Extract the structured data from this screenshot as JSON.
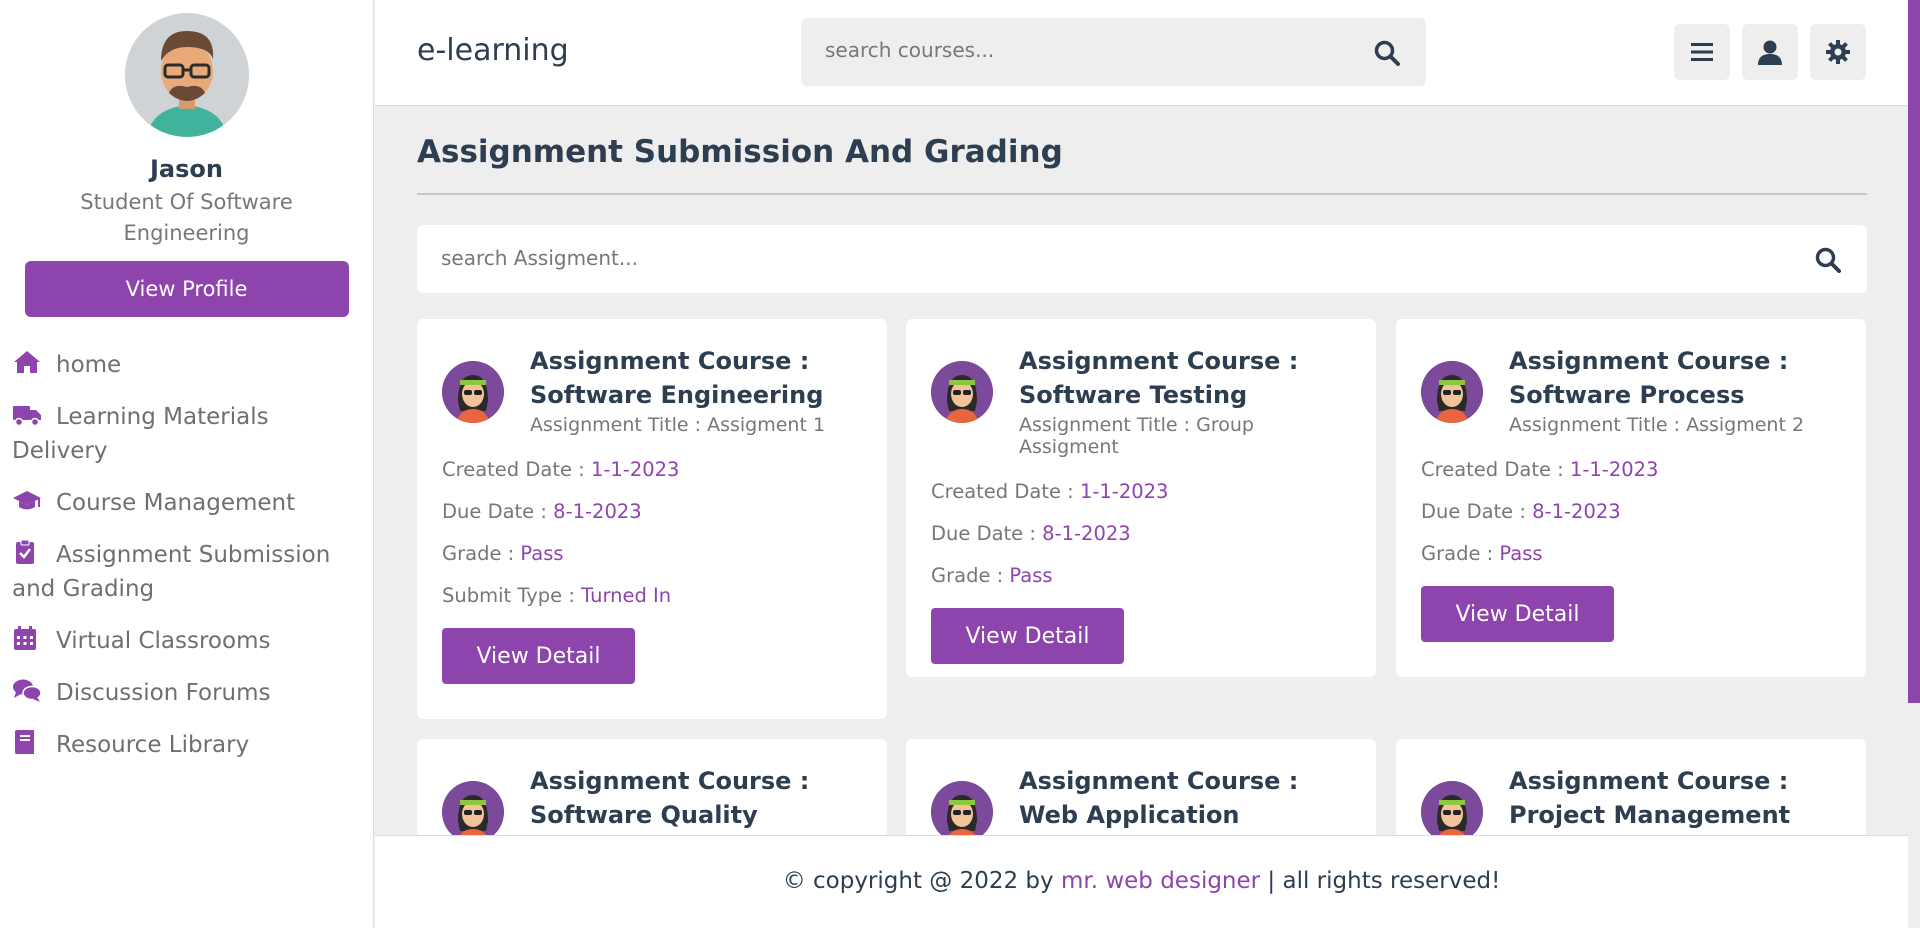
{
  "sidebar": {
    "profile": {
      "name": "Jason",
      "role": "Student Of Software Engineering",
      "button_label": "View Profile"
    },
    "items": [
      {
        "label": "home",
        "icon": "home-icon"
      },
      {
        "label": "Learning Materials Delivery",
        "icon": "truck-icon"
      },
      {
        "label": "Course Management",
        "icon": "graduation-cap-icon"
      },
      {
        "label": "Assignment Submission and Grading",
        "icon": "clipboard-check-icon"
      },
      {
        "label": "Virtual Classrooms",
        "icon": "calendar-icon"
      },
      {
        "label": "Discussion Forums",
        "icon": "comments-icon"
      },
      {
        "label": "Resource Library",
        "icon": "book-icon"
      }
    ]
  },
  "header": {
    "brand": "e-learning",
    "search_placeholder": "search courses...",
    "buttons": [
      "menu-icon",
      "user-icon",
      "settings-icon"
    ]
  },
  "main": {
    "title": "Assignment Submission And Grading",
    "search_placeholder": "search Assigment...",
    "cards": [
      {
        "course": "Assignment Course : Software Engineering",
        "assignment_title": "Assignment Title : Assigment 1",
        "created_label": "Created Date : ",
        "created": "1-1-2023",
        "due_label": "Due Date : ",
        "due": "8-1-2023",
        "grade_label": "Grade : ",
        "grade": "Pass",
        "submit_label": "Submit Type : ",
        "submit": "Turned In",
        "button_label": "View Detail"
      },
      {
        "course": "Assignment Course : Software Testing",
        "assignment_title": "Assignment Title : Group Assigment",
        "created_label": "Created Date : ",
        "created": "1-1-2023",
        "due_label": "Due Date : ",
        "due": "8-1-2023",
        "grade_label": "Grade : ",
        "grade": "Pass",
        "button_label": "View Detail"
      },
      {
        "course": "Assignment Course : Software Process",
        "assignment_title": "Assignment Title : Assigment 2",
        "created_label": "Created Date : ",
        "created": "1-1-2023",
        "due_label": "Due Date : ",
        "due": "8-1-2023",
        "grade_label": "Grade : ",
        "grade": "Pass",
        "button_label": "View Detail"
      },
      {
        "course": "Assignment Course : Software Quality"
      },
      {
        "course": "Assignment Course : Web Application"
      },
      {
        "course": "Assignment Course : Project Management"
      }
    ]
  },
  "footer": {
    "prefix": "© copyright @ 2022 by ",
    "link": "mr. web designer",
    "suffix": " | all rights reserved!"
  },
  "colors": {
    "accent": "#8e44ad",
    "background": "#eeeeee",
    "text": "#2c3e50"
  }
}
